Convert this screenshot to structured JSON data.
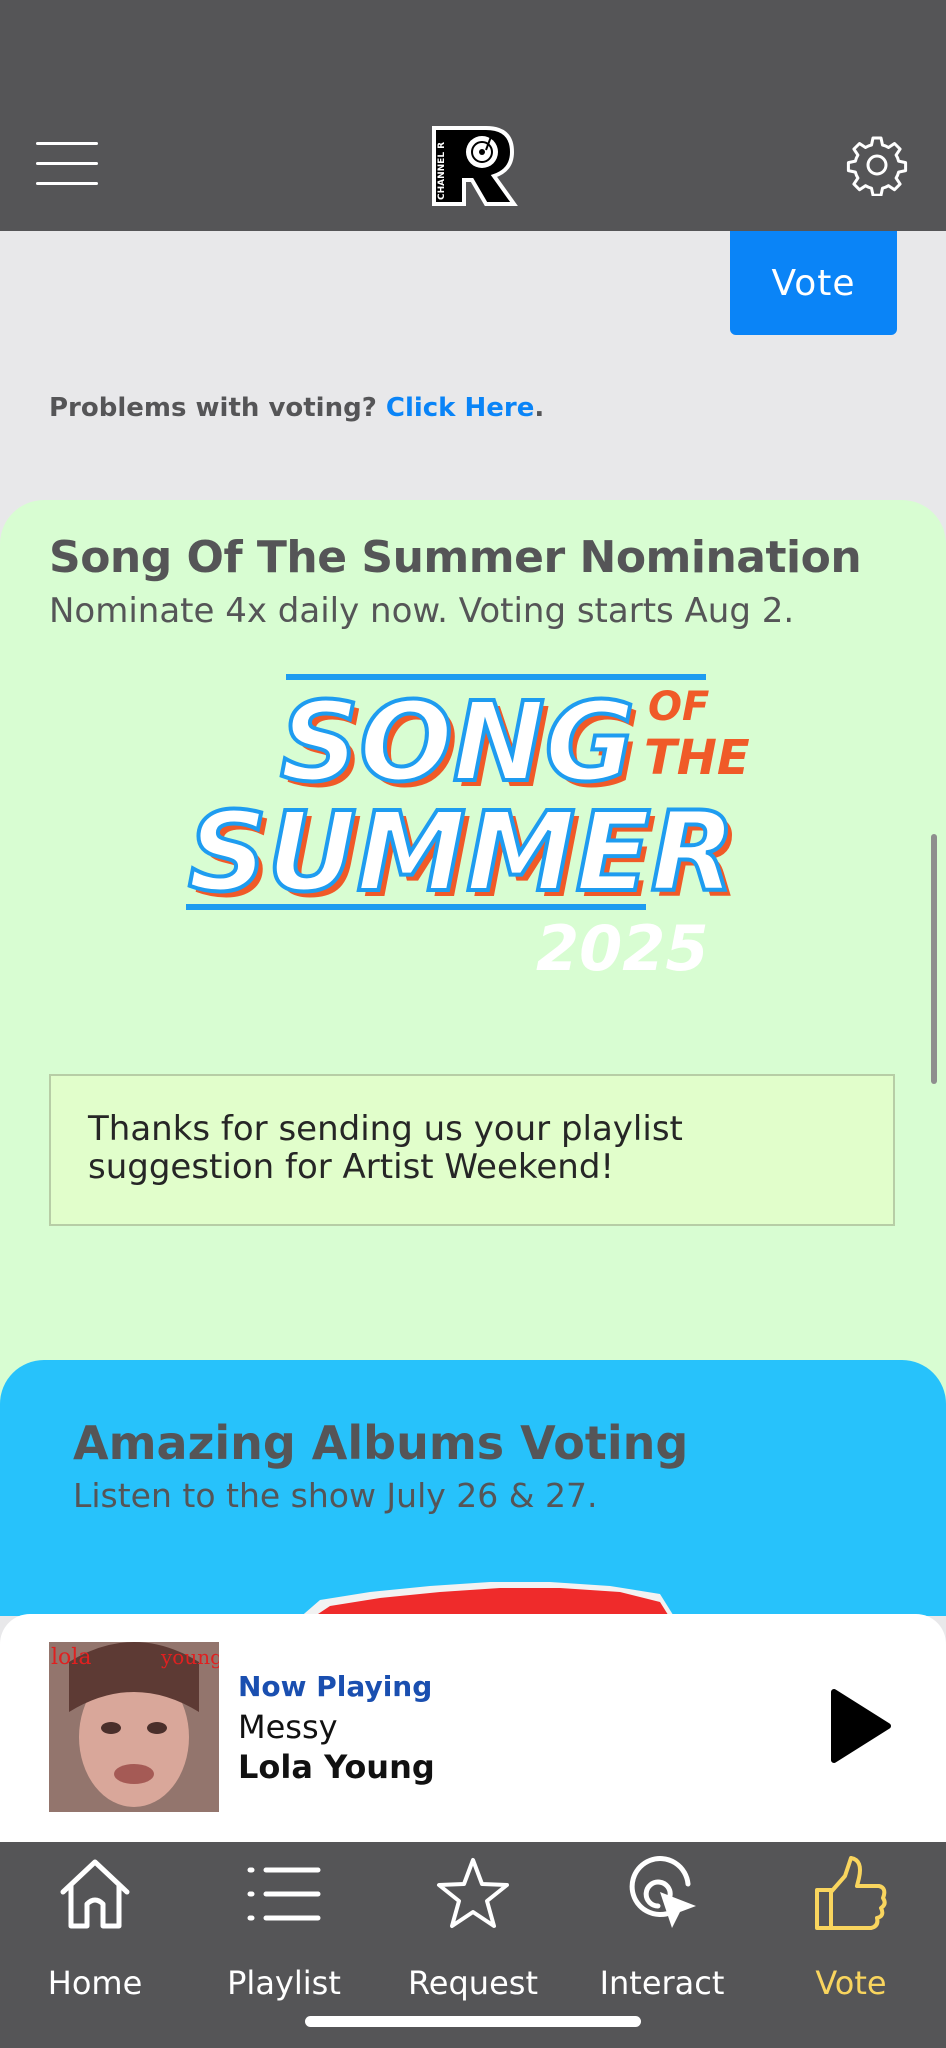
{
  "header": {
    "logo_text": "CHANNEL R"
  },
  "vote_section": {
    "vote_button": "Vote",
    "problems_text": "Problems with voting?",
    "problems_link": "Click Here",
    "problems_period": "."
  },
  "song_of_summer": {
    "title": "Song Of The Summer Nomination",
    "subtitle": "Nominate 4x daily now. Voting starts Aug 2.",
    "logo_text": {
      "line1": "SONG",
      "of": "OF",
      "the": "THE",
      "line2": "SUMMER",
      "year": "2025"
    },
    "notice": "Thanks for sending us your playlist suggestion for Artist Weekend!"
  },
  "amazing_albums": {
    "title": "Amazing Albums Voting",
    "subtitle": "Listen to the show July 26 & 27."
  },
  "player": {
    "label": "Now Playing",
    "song": "Messy",
    "artist": "Lola Young",
    "art_text_left": "lola",
    "art_text_right": "young"
  },
  "tabs": [
    {
      "label": "Home",
      "icon": "home-icon",
      "active": false
    },
    {
      "label": "Playlist",
      "icon": "list-icon",
      "active": false
    },
    {
      "label": "Request",
      "icon": "star-icon",
      "active": false
    },
    {
      "label": "Interact",
      "icon": "interact-icon",
      "active": false
    },
    {
      "label": "Vote",
      "icon": "thumbs-up-icon",
      "active": true
    }
  ],
  "colors": {
    "accent_blue": "#0a84f7",
    "active_tab": "#f9d55e",
    "green_card": "#d8fdd2",
    "blue_card": "#27c2fb",
    "bars": "#555557"
  }
}
